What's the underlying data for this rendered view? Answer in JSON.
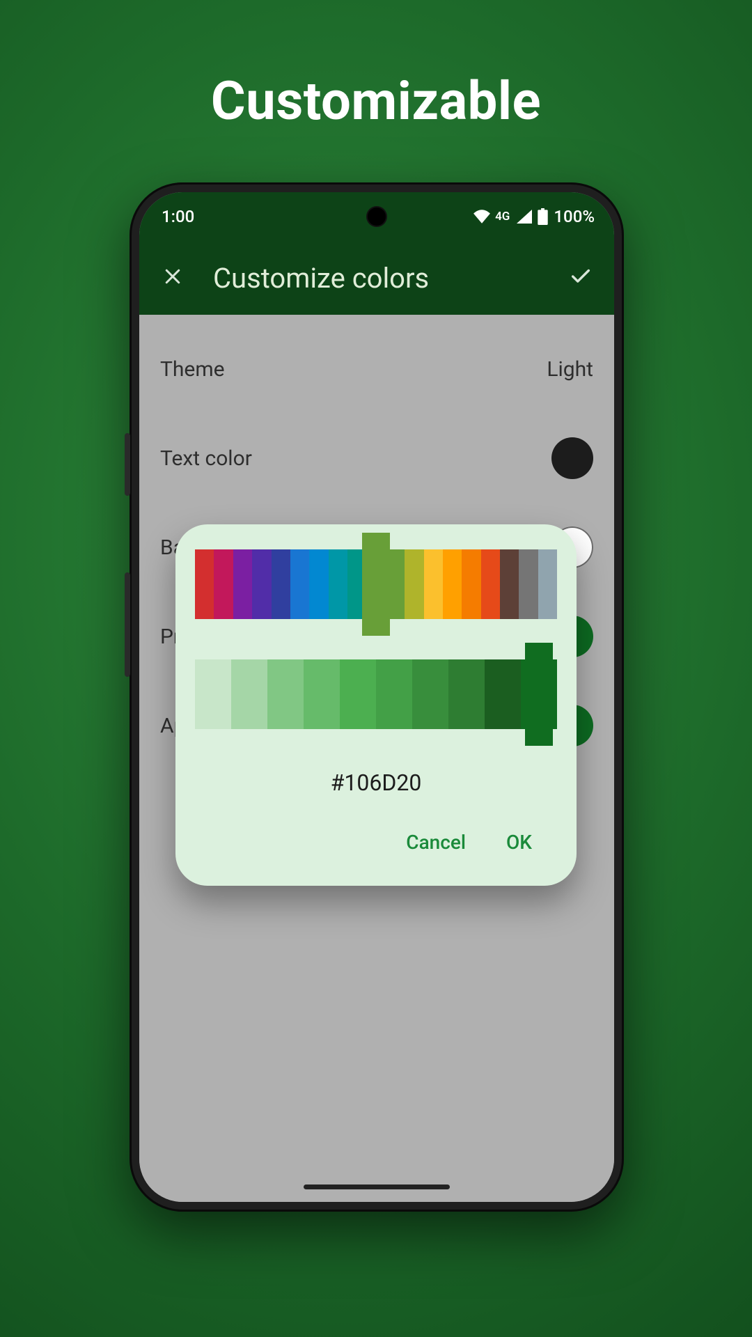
{
  "promo": {
    "title": "Customizable"
  },
  "status": {
    "time": "1:00",
    "network_label": "4G",
    "battery_text": "100%"
  },
  "appbar": {
    "title": "Customize colors"
  },
  "settings": {
    "theme": {
      "label": "Theme",
      "value": "Light"
    },
    "text_color": {
      "label": "Text color",
      "swatch": "#1c1c1c"
    },
    "background": {
      "label": "Background color",
      "swatch": "#ffffff"
    },
    "primary": {
      "label": "Primary color",
      "swatch": "#0d6b22"
    },
    "app_icon": {
      "label": "App icon color",
      "swatch": "#0d6b22"
    }
  },
  "picker": {
    "hex": "#106D20",
    "cancel": "Cancel",
    "ok": "OK",
    "hue_colors": [
      "#d32f2f",
      "#c2185b",
      "#7b1fa2",
      "#512da8",
      "#303f9f",
      "#1976d2",
      "#0288d1",
      "#0097a7",
      "#009688",
      "#388e3c",
      "#689f38",
      "#afb42b",
      "#fbc02d",
      "#ffa000",
      "#f57c00",
      "#e64a19",
      "#5d4037",
      "#757575",
      "#90a4ae"
    ],
    "hue_thumb_color": "#689f38",
    "hue_thumb_index": 9,
    "shade_colors": [
      "#c8e6c9",
      "#a5d6a7",
      "#81c784",
      "#66bb6a",
      "#4caf50",
      "#43a047",
      "#388e3c",
      "#2e7d32",
      "#1b5e20",
      "#106d20"
    ],
    "shade_thumb_color": "#106d20",
    "shade_thumb_index": 9
  }
}
